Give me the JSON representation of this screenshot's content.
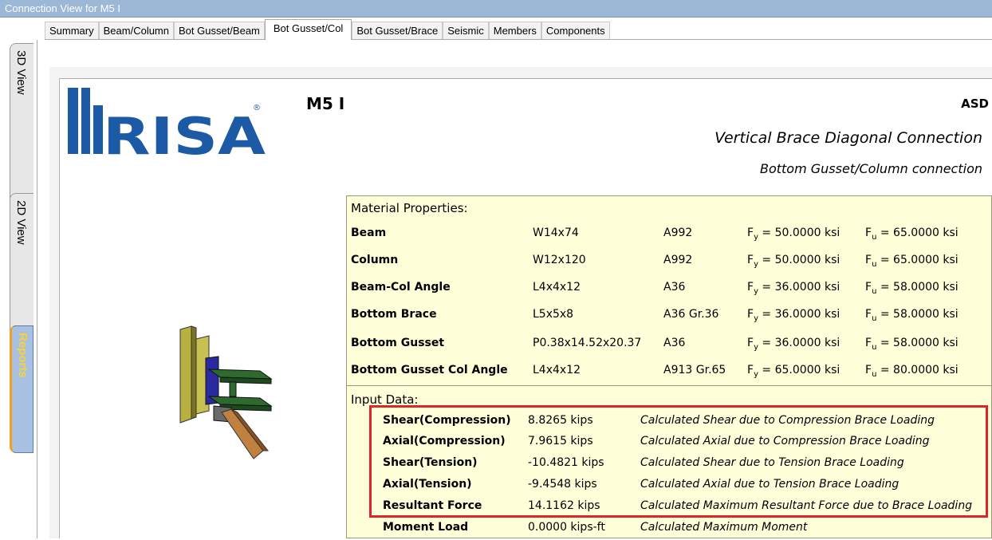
{
  "window": {
    "title": "Connection View for M5 I"
  },
  "tabs": [
    "Summary",
    "Beam/Column",
    "Bot Gusset/Beam",
    "Bot Gusset/Col",
    "Bot Gusset/Brace",
    "Seismic",
    "Members",
    "Components"
  ],
  "active_tab": "Bot Gusset/Col",
  "side_tabs": [
    "3D View",
    "2D View",
    "Reports"
  ],
  "active_side_tab": "Reports",
  "report": {
    "logo_text": "RISA",
    "logo_mark": "®",
    "model_name": "M5 I",
    "method": "ASD",
    "title": "Vertical Brace Diagonal Connection",
    "subtitle": "Bottom Gusset/Column connection",
    "material_label": "Material Properties:",
    "input_label": "Input Data:",
    "materials": [
      {
        "name": "Beam",
        "shape": "W14x74",
        "grade": "A992",
        "fy_prefix": "F",
        "fy_sub": "y",
        "fy": " = 50.0000 ksi",
        "fu_prefix": "F",
        "fu_sub": "u",
        "fu": " = 65.0000 ksi"
      },
      {
        "name": "Column",
        "shape": "W12x120",
        "grade": "A992",
        "fy_prefix": "F",
        "fy_sub": "y",
        "fy": " = 50.0000 ksi",
        "fu_prefix": "F",
        "fu_sub": "u",
        "fu": " = 65.0000 ksi"
      },
      {
        "name": "Beam-Col Angle",
        "shape": "L4x4x12",
        "grade": "A36",
        "fy_prefix": "F",
        "fy_sub": "y",
        "fy": " = 36.0000 ksi",
        "fu_prefix": "F",
        "fu_sub": "u",
        "fu": " = 58.0000 ksi"
      },
      {
        "name": "Bottom Brace",
        "shape": "L5x5x8",
        "grade": "A36 Gr.36",
        "fy_prefix": "F",
        "fy_sub": "y",
        "fy": " = 36.0000 ksi",
        "fu_prefix": "F",
        "fu_sub": "u",
        "fu": " = 58.0000 ksi"
      },
      {
        "name": "Bottom Gusset",
        "shape": "P0.38x14.52x20.37",
        "grade": "A36",
        "fy_prefix": "F",
        "fy_sub": "y",
        "fy": " = 36.0000 ksi",
        "fu_prefix": "F",
        "fu_sub": "u",
        "fu": " = 58.0000 ksi"
      },
      {
        "name": "Bottom Gusset Col Angle",
        "shape": "L4x4x12",
        "grade": "A913 Gr.65",
        "fy_prefix": "F",
        "fy_sub": "y",
        "fy": " = 65.0000 ksi",
        "fu_prefix": "F",
        "fu_sub": "u",
        "fu": " = 80.0000 ksi"
      }
    ],
    "inputs": [
      {
        "name": "Shear(Compression)",
        "value": "8.8265 kips",
        "desc": "Calculated Shear due to Compression Brace Loading"
      },
      {
        "name": "Axial(Compression)",
        "value": "7.9615 kips",
        "desc": "Calculated Axial due to Compression Brace Loading"
      },
      {
        "name": "Shear(Tension)",
        "value": "-10.4821 kips",
        "desc": "Calculated Shear due to Tension Brace Loading"
      },
      {
        "name": "Axial(Tension)",
        "value": "-9.4548 kips",
        "desc": "Calculated Axial due to Tension Brace Loading"
      },
      {
        "name": "Resultant Force",
        "value": "14.1162 kips",
        "desc": "Calculated Maximum Resultant Force due to Brace Loading"
      },
      {
        "name": "Moment Load",
        "value": "0.0000 kips-ft",
        "desc": "Calculated Maximum Moment"
      }
    ]
  },
  "colors": {
    "logo_blue": "#1c5aa6",
    "report_bg": "#ffffd9",
    "highlight_red": "#e0242a",
    "titlebar": "#9db7d6",
    "reports_tab_text": "#f6d23a"
  }
}
